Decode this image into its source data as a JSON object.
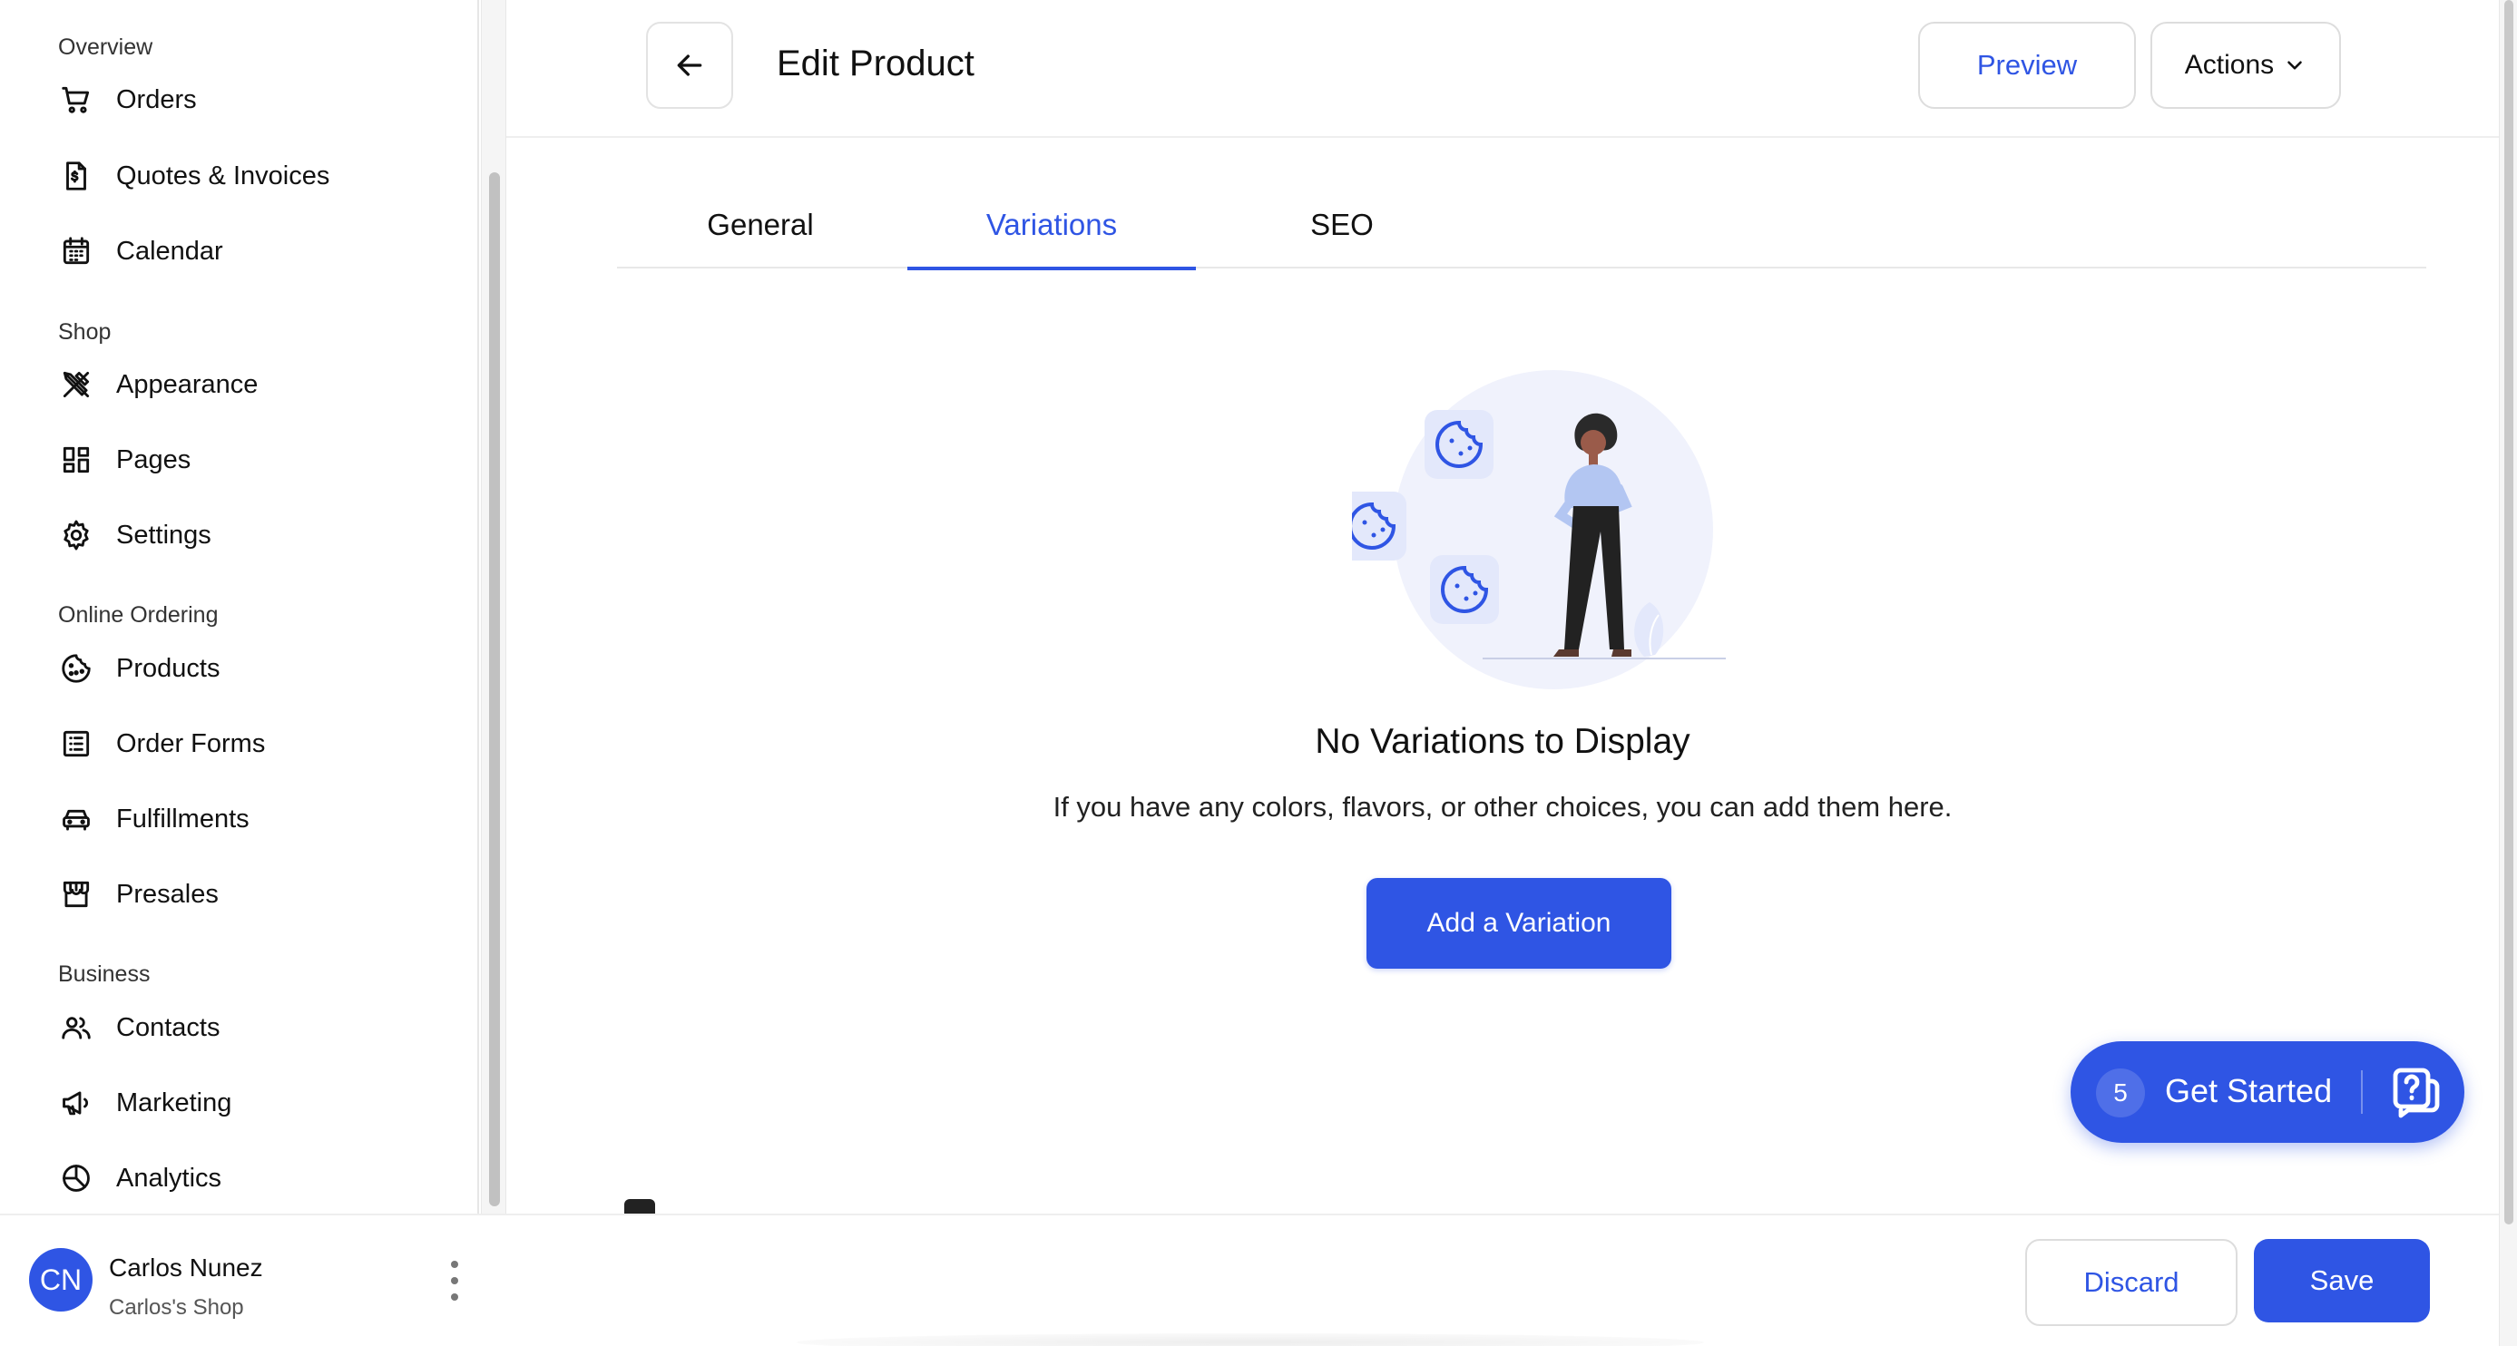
{
  "sidebar": {
    "sections": [
      {
        "label": "Overview",
        "items": [
          {
            "label": "Orders",
            "icon": "cart-icon"
          },
          {
            "label": "Quotes & Invoices",
            "icon": "invoice-icon"
          },
          {
            "label": "Calendar",
            "icon": "calendar-icon"
          }
        ]
      },
      {
        "label": "Shop",
        "items": [
          {
            "label": "Appearance",
            "icon": "design-tools-icon"
          },
          {
            "label": "Pages",
            "icon": "layout-grid-icon"
          },
          {
            "label": "Settings",
            "icon": "gear-icon"
          }
        ]
      },
      {
        "label": "Online Ordering",
        "items": [
          {
            "label": "Products",
            "icon": "cookie-icon"
          },
          {
            "label": "Order Forms",
            "icon": "list-form-icon"
          },
          {
            "label": "Fulfillments",
            "icon": "car-icon"
          },
          {
            "label": "Presales",
            "icon": "storefront-icon"
          }
        ]
      },
      {
        "label": "Business",
        "items": [
          {
            "label": "Contacts",
            "icon": "people-icon"
          },
          {
            "label": "Marketing",
            "icon": "megaphone-icon"
          },
          {
            "label": "Analytics",
            "icon": "pie-chart-icon"
          }
        ]
      }
    ],
    "user": {
      "initials": "CN",
      "name": "Carlos Nunez",
      "shop": "Carlos's Shop"
    }
  },
  "header": {
    "title": "Edit Product",
    "preview_label": "Preview",
    "actions_label": "Actions"
  },
  "tabs": [
    {
      "label": "General",
      "active": false
    },
    {
      "label": "Variations",
      "active": true
    },
    {
      "label": "SEO",
      "active": false
    }
  ],
  "empty_state": {
    "title": "No Variations to Display",
    "description": "If you have any colors, flavors, or other choices, you can add them here.",
    "button_label": "Add a Variation"
  },
  "get_started": {
    "count": "5",
    "label": "Get Started"
  },
  "footer_bar": {
    "discard_label": "Discard",
    "save_label": "Save"
  },
  "colors": {
    "accent": "#2f55e4",
    "illustration_bg": "#f0f2fc",
    "border": "#e6e6e6"
  }
}
